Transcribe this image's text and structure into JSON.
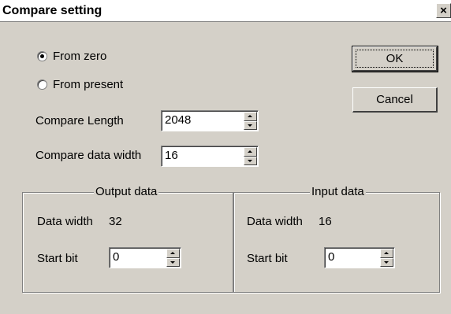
{
  "dialog": {
    "title": "Compare setting",
    "close_label": "×"
  },
  "mode": {
    "options": [
      {
        "label": "From zero",
        "selected": true
      },
      {
        "label": "From present",
        "selected": false
      }
    ]
  },
  "buttons": {
    "ok": "OK",
    "cancel": "Cancel"
  },
  "compare_length": {
    "label": "Compare Length",
    "value": "2048"
  },
  "compare_data_width": {
    "label": "Compare data width",
    "value": "16"
  },
  "output": {
    "title": "Output data",
    "data_width_label": "Data width",
    "data_width_value": "32",
    "start_bit_label": "Start bit",
    "start_bit_value": "0"
  },
  "input": {
    "title": "Input data",
    "data_width_label": "Data width",
    "data_width_value": "16",
    "start_bit_label": "Start bit",
    "start_bit_value": "0"
  }
}
